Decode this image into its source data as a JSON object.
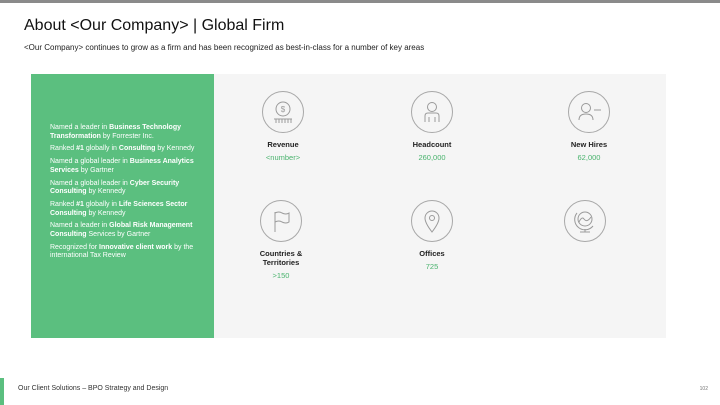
{
  "header": {
    "title": "About <Our Company> | Global Firm",
    "subtitle": "<Our Company> continues to grow as a firm and has been recognized as best-in-class for a number of key areas"
  },
  "awards": [
    {
      "pre": "Named a leader in ",
      "bold": "Business Technology Transformation",
      "post": " by Forrester Inc."
    },
    {
      "pre": "Ranked ",
      "bold": "#1",
      "post": " globally in ",
      "bold2": "Consulting",
      "post2": " by Kennedy"
    },
    {
      "pre": "Named a global leader in ",
      "bold": "Business Analytics Services",
      "post": " by Gartner"
    },
    {
      "pre": "Named a global leader in ",
      "bold": "Cyber Security Consulting",
      "post": " by Kennedy"
    },
    {
      "pre": "Ranked ",
      "bold": "#1",
      "post": " globally in ",
      "bold2": "Life Sciences Sector Consulting",
      "post2": " by Kennedy"
    },
    {
      "pre": "Named a leader in ",
      "bold": "Global Risk Management Consulting",
      "post": " Services by Gartner"
    },
    {
      "pre": "Recognized for ",
      "bold": "Innovative client work",
      "post": " by the international Tax Review"
    }
  ],
  "stats": [
    {
      "icon": "revenue-icon",
      "label": "Revenue",
      "value": "<number>"
    },
    {
      "icon": "headcount-icon",
      "label": "Headcount",
      "value": "260,000"
    },
    {
      "icon": "new-hires-icon",
      "label": "New Hires",
      "value": "62,000"
    },
    {
      "icon": "flag-icon",
      "label": "Countries & Territories",
      "value": ">150"
    },
    {
      "icon": "location-pin-icon",
      "label": "Offices",
      "value": "725"
    },
    {
      "icon": "globe-icon",
      "label": "",
      "value": ""
    }
  ],
  "footer": {
    "text": "Our Client Solutions – BPO Strategy and Design",
    "page": "102"
  },
  "colors": {
    "accent": "#5bbf7f",
    "value": "#49b36d",
    "panel": "#f5f5f5"
  }
}
